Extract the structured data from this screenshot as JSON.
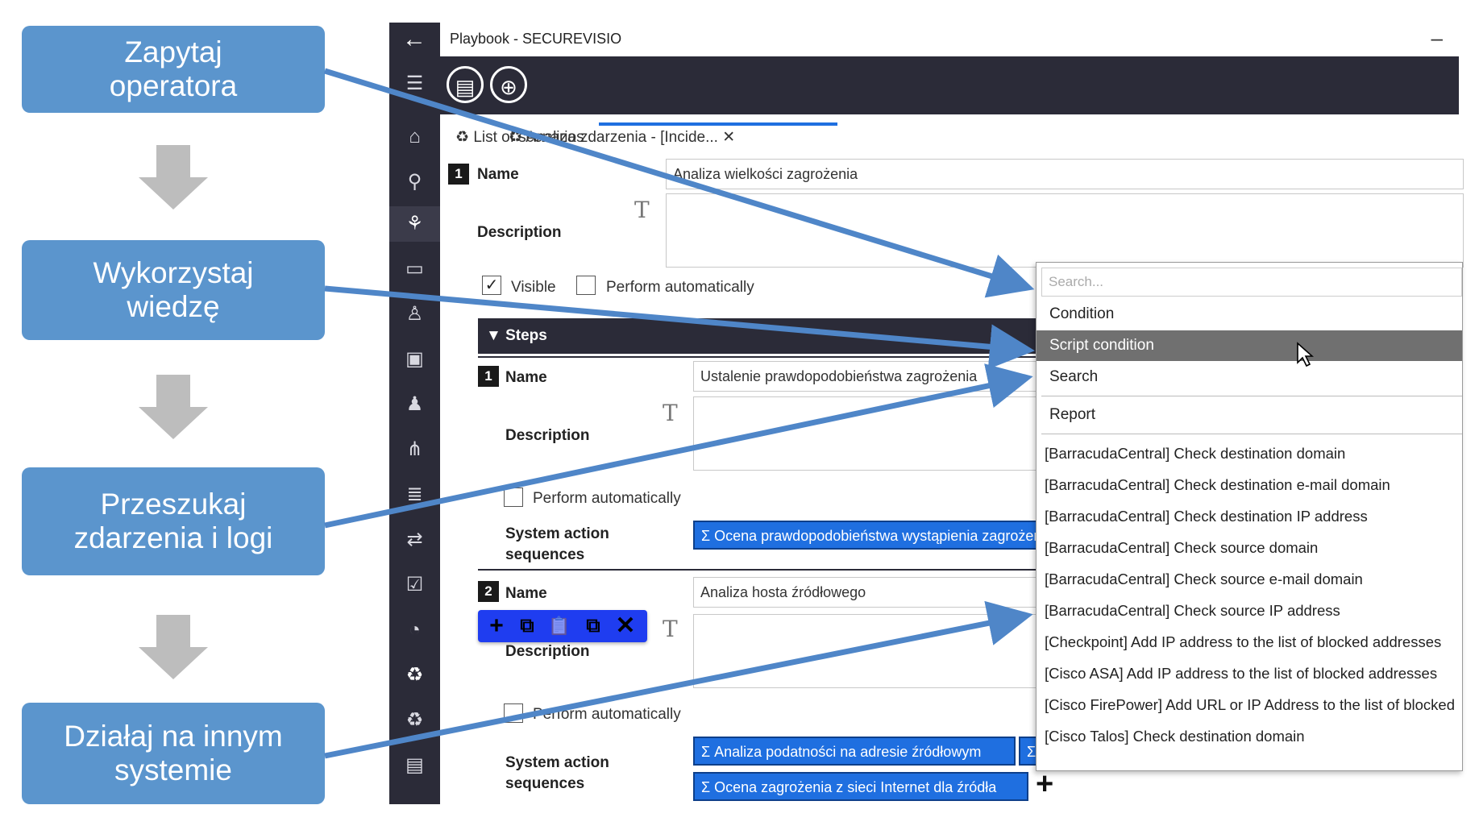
{
  "flow": {
    "steps": [
      {
        "label": "Zapytaj\noperatora"
      },
      {
        "label": "Wykorzystaj\nwiedzę"
      },
      {
        "label": "Przeszukaj\nzdarzenia i logi"
      },
      {
        "label": "Działaj na innym\nsystemie"
      }
    ],
    "color": "#5b95cd"
  },
  "app": {
    "title": "Playbook -  SECUREVISIO",
    "minimize": "–",
    "tabs": [
      {
        "label": "List of scenarios"
      },
      {
        "label": "Analiza zdarzenia - [Incide...",
        "close": "✕"
      }
    ],
    "scenario": {
      "number": "1",
      "name_label": "Name",
      "name_value": "Analiza wielkości zagrożenia",
      "description_label": "Description",
      "visible_label": "Visible",
      "visible_checked": true,
      "auto_label": "Perform automatically",
      "auto_checked": false
    },
    "steps_header": "Steps",
    "steps": [
      {
        "number": "1",
        "name_label": "Name",
        "name_value": "Ustalenie prawdopodobieństwa zagrożenia",
        "description_label": "Description",
        "auto_label": "Perform automatically",
        "seq_label": "System action\nsequences",
        "sequences": [
          "Σ  Ocena prawdopodobieństwa wystąpienia zagrożenia"
        ]
      },
      {
        "number": "2",
        "name_label": "Name",
        "name_value": "Analiza hosta źródłowego",
        "description_label": "Description",
        "auto_label": "Perform automatically",
        "seq_label": "System action\nsequences",
        "sequences": [
          "Σ  Analiza podatności na adresie źródłowym",
          "Σ",
          "Σ  Ocena zagrożenia z sieci Internet dla źródła"
        ]
      }
    ],
    "mini_toolbar": [
      "+",
      "⧉",
      "📋",
      "⧉",
      "✕"
    ],
    "add_icon": "+",
    "colors": {
      "dark": "#2b2b38",
      "accent": "#1f6fe0",
      "selected": "#707070"
    }
  },
  "dropdown": {
    "search_placeholder": "Search...",
    "items": [
      "Condition",
      "Script condition",
      "Search",
      "Report",
      "[BarracudaCentral] Check destination domain",
      "[BarracudaCentral] Check destination e-mail domain",
      "[BarracudaCentral] Check destination IP address",
      "[BarracudaCentral] Check source domain",
      "[BarracudaCentral] Check source e-mail domain",
      "[BarracudaCentral] Check source IP address",
      "[Checkpoint] Add IP address to the list of blocked addresses",
      "[Cisco ASA] Add IP address to the list of blocked addresses",
      "[Cisco FirePower] Add URL or IP Address to the list of blocked",
      "[Cisco Talos] Check destination domain"
    ],
    "selected": "Script condition"
  }
}
